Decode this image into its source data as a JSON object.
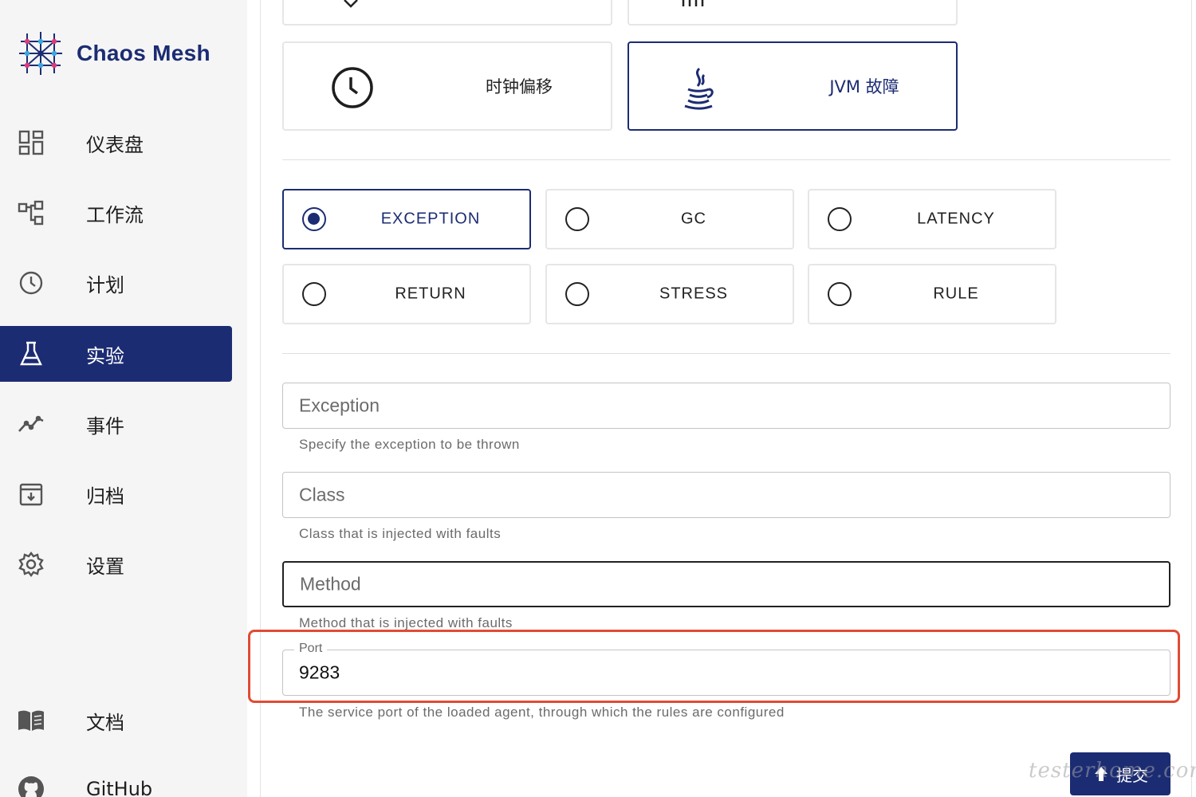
{
  "app": {
    "brand_name": "Chaos Mesh",
    "accent_color": "#1c2c73",
    "highlight_color": "#e04b35"
  },
  "sidebar": {
    "items": [
      {
        "label": "仪表盘",
        "icon": "dashboard-icon"
      },
      {
        "label": "工作流",
        "icon": "workflow-icon"
      },
      {
        "label": "计划",
        "icon": "schedule-icon"
      },
      {
        "label": "实验",
        "icon": "experiment-flask-icon",
        "active": true
      },
      {
        "label": "事件",
        "icon": "events-chart-icon"
      },
      {
        "label": "归档",
        "icon": "archive-icon"
      },
      {
        "label": "设置",
        "icon": "settings-gear-icon"
      }
    ],
    "bottom_items": [
      {
        "label": "文档",
        "icon": "docs-book-icon"
      },
      {
        "label": "GitHub",
        "icon": "github-icon"
      }
    ]
  },
  "fault_types": {
    "items": [
      {
        "label": "时钟偏移",
        "icon": "clock-icon",
        "selected": false
      },
      {
        "label": "JVM 故障",
        "icon": "java-icon",
        "selected": true
      }
    ]
  },
  "actions": {
    "items": [
      {
        "label": "EXCEPTION",
        "selected": true
      },
      {
        "label": "GC",
        "selected": false
      },
      {
        "label": "LATENCY",
        "selected": false
      },
      {
        "label": "RETURN",
        "selected": false
      },
      {
        "label": "STRESS",
        "selected": false
      },
      {
        "label": "RULE",
        "selected": false
      }
    ]
  },
  "form": {
    "exception": {
      "placeholder": "Exception",
      "helper": "Specify the exception to be thrown",
      "value": ""
    },
    "class": {
      "placeholder": "Class",
      "helper": "Class that is injected with faults",
      "value": ""
    },
    "method": {
      "placeholder": "Method",
      "helper": "Method that is injected with faults",
      "value": ""
    },
    "port": {
      "label": "Port",
      "value": "9283",
      "helper": "The service port of the loaded agent, through which the rules are configured"
    }
  },
  "submit": {
    "label": "提交",
    "icon": "upload-arrow-icon"
  },
  "watermark": "testerhome.com"
}
